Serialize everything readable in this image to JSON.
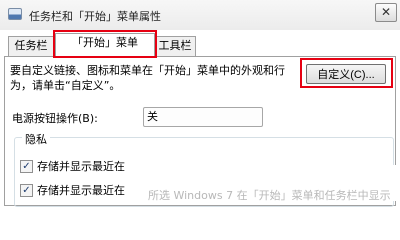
{
  "window": {
    "title": "任务栏和「开始」菜单属性",
    "close_glyph": "✕"
  },
  "tabs": [
    {
      "label": "任务栏"
    },
    {
      "label": "「开始」菜单"
    },
    {
      "label": "工具栏"
    }
  ],
  "start_menu": {
    "description": "要自定义链接、图标和菜单在「开始」菜单中的外观和行为，请单击“自定义”。",
    "customize_button": "自定义(C)...",
    "power_label": "电源按钮操作(B):",
    "power_value": "关",
    "privacy": {
      "title": "隐私",
      "options": [
        {
          "label": "存储并显示最近在",
          "checked": true
        },
        {
          "label": "存储并显示最近在",
          "checked": true
        }
      ]
    }
  },
  "overlay_caption": "所选 Windows 7 在「开始」菜单和任务栏中显示",
  "colors": {
    "highlight_box": "#e60012"
  }
}
